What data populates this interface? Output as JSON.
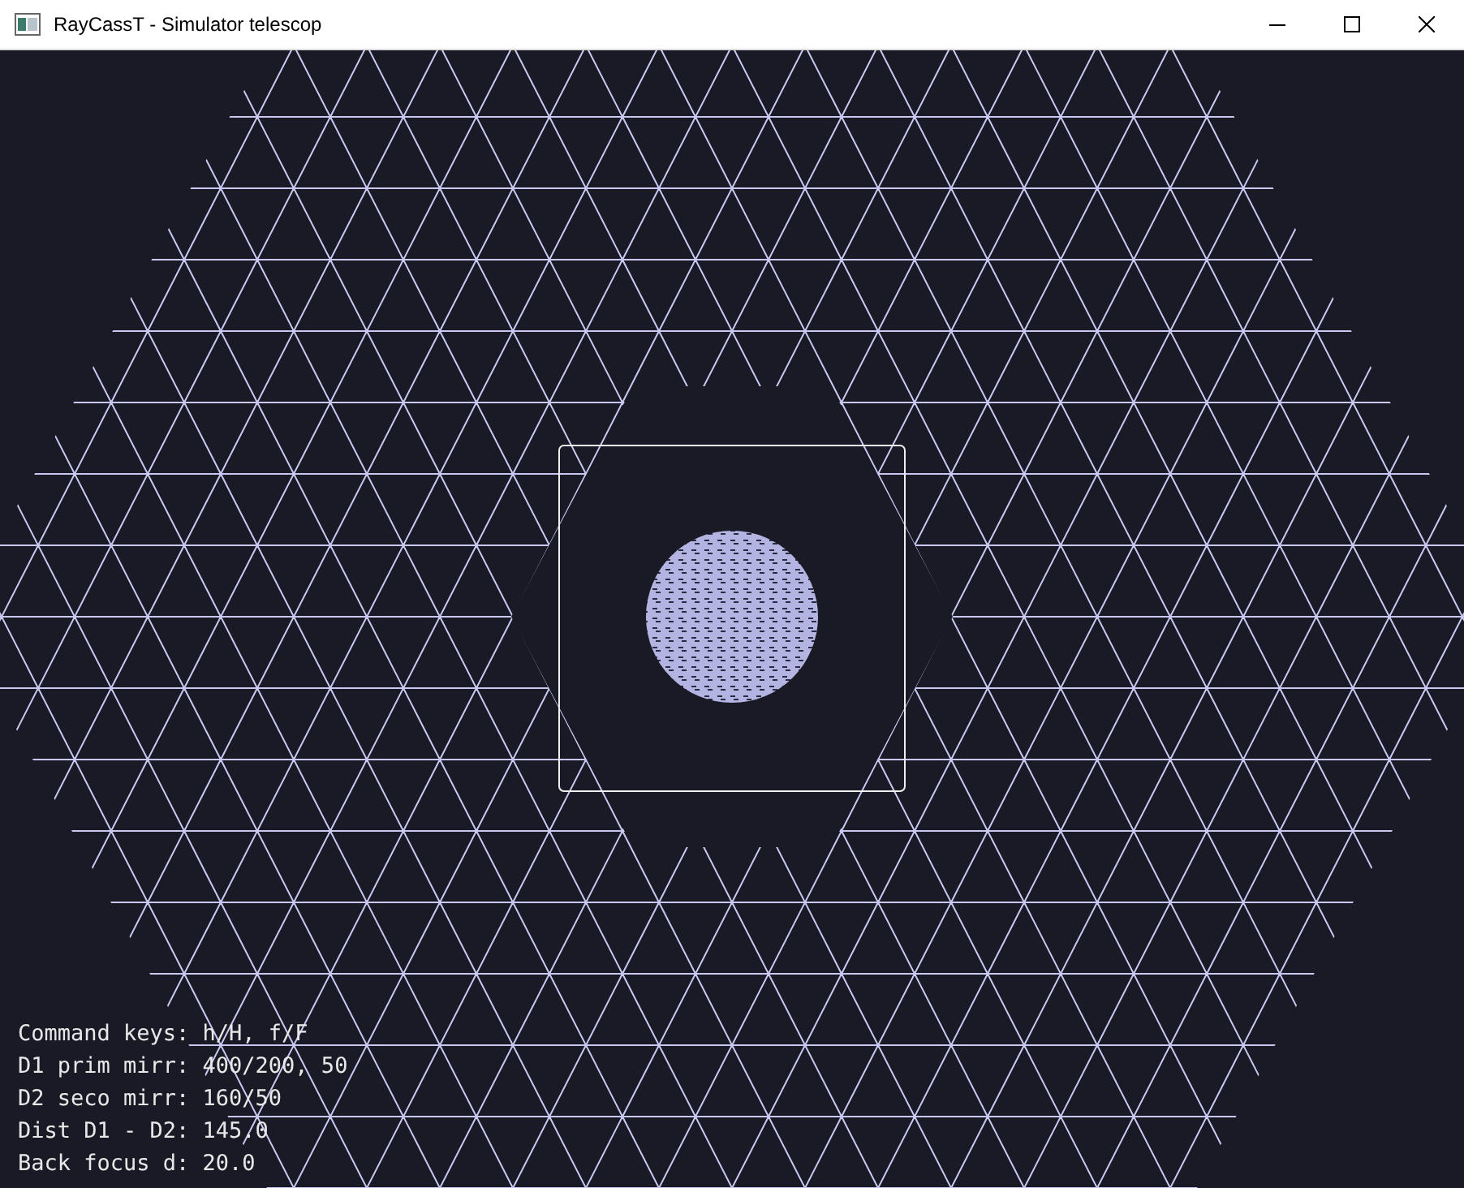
{
  "window": {
    "title": "RayCassT - Simulator telescop"
  },
  "info_lines": [
    "Command keys: h/H, f/F",
    "D1 prim mirr: 400/200, 50",
    "D2 seco mirr: 160/50",
    "Dist D1 - D2: 145.0",
    "Back focus d: 20.0"
  ]
}
